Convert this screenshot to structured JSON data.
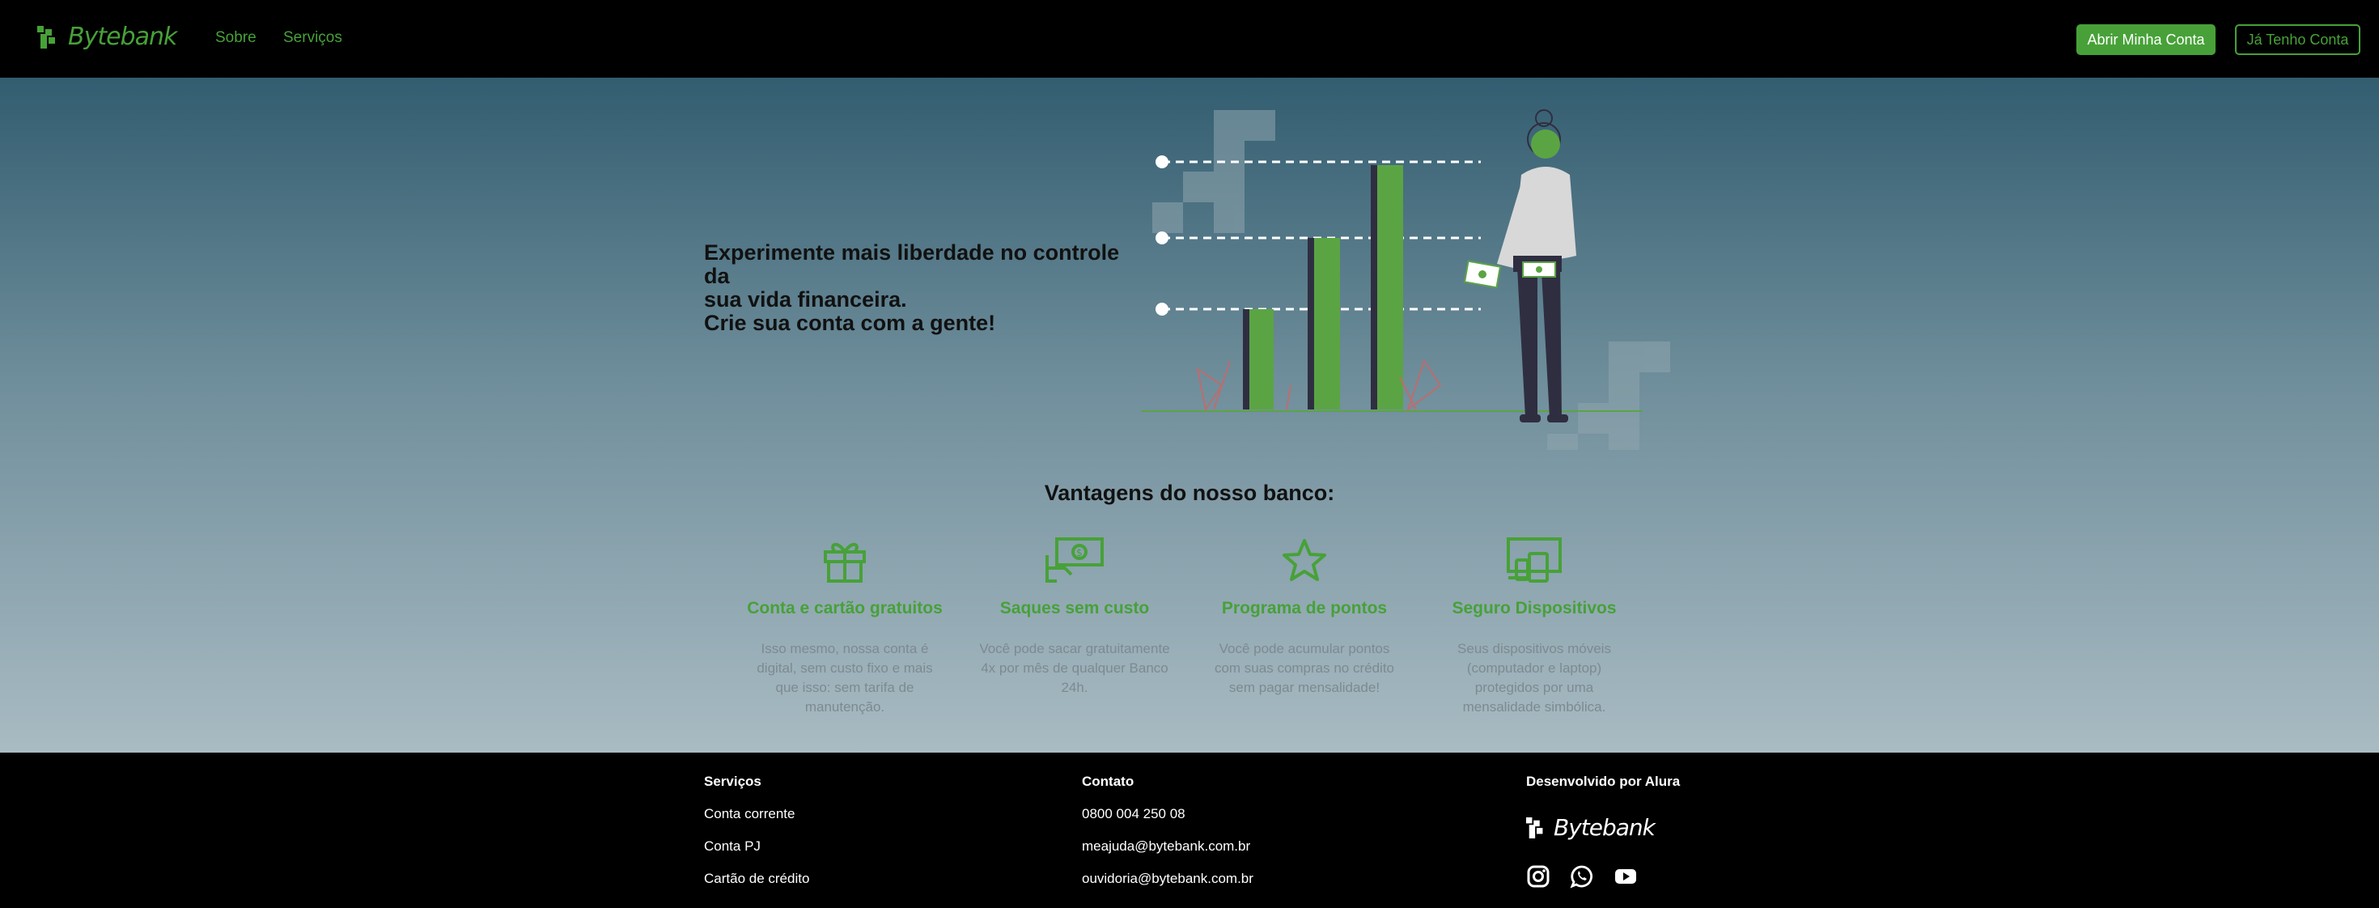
{
  "brand": {
    "name": "Bytebank",
    "accent": "#47a138"
  },
  "header": {
    "nav": [
      {
        "label": "Sobre"
      },
      {
        "label": "Serviços"
      }
    ],
    "primary_button": "Abrir Minha Conta",
    "secondary_button": "Já Tenho Conta"
  },
  "hero": {
    "line1": "Experimente mais liberdade no controle da",
    "line2": "sua vida financeira.",
    "line3": "Crie sua conta com a gente!"
  },
  "benefits": {
    "title": "Vantagens do nosso banco:",
    "items": [
      {
        "icon": "gift-icon",
        "title": "Conta e cartão gratuitos",
        "text": "Isso mesmo, nossa conta é digital, sem custo fixo e mais que isso: sem tarifa de manutenção."
      },
      {
        "icon": "cash-withdrawal-icon",
        "title": "Saques sem custo",
        "text": "Você pode sacar gratuitamente 4x por mês de qualquer Banco 24h."
      },
      {
        "icon": "star-icon",
        "title": "Programa de pontos",
        "text": "Você pode acumular pontos com suas compras no crédito sem pagar mensalidade!"
      },
      {
        "icon": "devices-icon",
        "title": "Seguro Dispositivos",
        "text": "Seus dispositivos móveis (computador e laptop) protegidos por uma mensalidade simbólica."
      }
    ]
  },
  "footer": {
    "services": {
      "title": "Serviços",
      "items": [
        "Conta corrente",
        "Conta PJ",
        "Cartão de crédito"
      ]
    },
    "contact": {
      "title": "Contato",
      "items": [
        "0800 004 250 08",
        "meajuda@bytebank.com.br",
        "ouvidoria@bytebank.com.br"
      ]
    },
    "dev": {
      "title": "Desenvolvido por Alura",
      "logo_text": "Bytebank"
    },
    "social": [
      "instagram-icon",
      "whatsapp-icon",
      "youtube-icon"
    ]
  }
}
